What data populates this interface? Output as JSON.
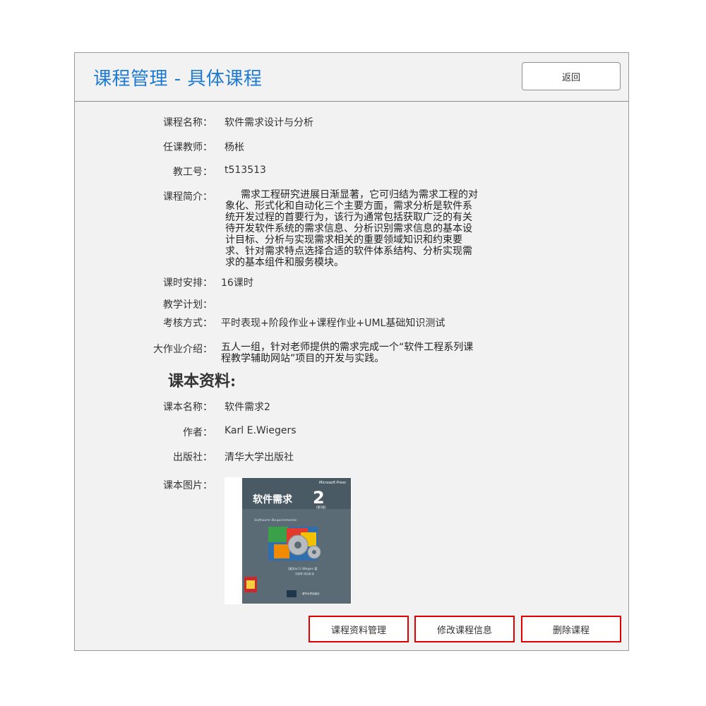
{
  "header": {
    "title": "课程管理 - 具体课程",
    "back_label": "返回"
  },
  "course": {
    "name_label": "课程名称：",
    "name": "软件需求设计与分析",
    "teacher_label": "任课教师：",
    "teacher": "杨枨",
    "staff_id_label": "教工号：",
    "staff_id": "t513513",
    "intro_label": "课程简介：",
    "intro": "需求工程研究进展日渐显著，它可归结为需求工程的对象化、形式化和自动化三个主要方面，需求分析是软件系统开发过程的首要行为，该行为通常包括获取广泛的有关待开发软件系统的需求信息、分析识别需求信息的基本设计目标、分析与实现需求相关的重要领域知识和约束要求、针对需求特点选择合适的软件体系结构、分析实现需求的基本组件和服务模块。",
    "hours_label": "课时安排：",
    "hours": "16课时",
    "plan_label": "教学计划：",
    "plan": "",
    "exam_label": "考核方式：",
    "exam": "平时表现+阶段作业+课程作业+UML基础知识测试",
    "assignment_label": "大作业介绍：",
    "assignment": "五人一组，针对老师提供的需求完成一个“软件工程系列课程教学辅助网站”项目的开发与实践。"
  },
  "textbook": {
    "section_title": "课本资料:",
    "name_label": "课本名称：",
    "name": "软件需求2",
    "author_label": "作者：",
    "author": "Karl E.Wiegers",
    "publisher_label": "出版社：",
    "publisher": "清华大学出版社",
    "image_label": "课本图片：",
    "cover": {
      "brand": "Microsoft Press",
      "title": "软件需求",
      "number": "2",
      "edition": "(第2版)",
      "subtitle": "Software Requirements",
      "author": "[美]Karl E.Wiegers 著",
      "translators": "刘伟琴 刘洪涛 译",
      "publisher": "清华大学出版社"
    }
  },
  "actions": {
    "materials_label": "课程资料管理",
    "edit_label": "修改课程信息",
    "delete_label": "删除课程"
  },
  "colors": {
    "title_blue": "#1f7ad1",
    "action_border_red": "#e00000",
    "panel_bg": "#f2f2f2"
  }
}
